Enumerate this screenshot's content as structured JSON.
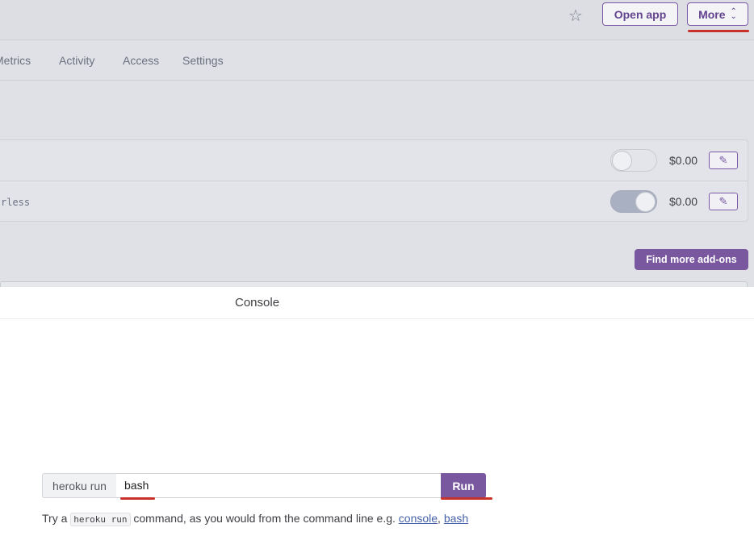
{
  "header": {
    "open_app_label": "Open app",
    "more_label": "More"
  },
  "tabs": [
    {
      "label": "Metrics"
    },
    {
      "label": "Activity"
    },
    {
      "label": "Access"
    },
    {
      "label": "Settings"
    }
  ],
  "addons": [
    {
      "label": "",
      "enabled": false,
      "price": "$0.00"
    },
    {
      "label": "rless",
      "enabled": true,
      "price": "$0.00"
    }
  ],
  "find_addons_label": "Find more add-ons",
  "console": {
    "title": "Console",
    "prefix": "heroku run",
    "input_value": "bash",
    "run_label": "Run",
    "hint": {
      "before": "Try a ",
      "code": "heroku run",
      "middle": " command, as you would from the command line e.g. ",
      "link1": "console",
      "sep": ", ",
      "link2": "bash"
    }
  },
  "colors": {
    "accent": "#79589f",
    "highlight": "#c8302a"
  }
}
